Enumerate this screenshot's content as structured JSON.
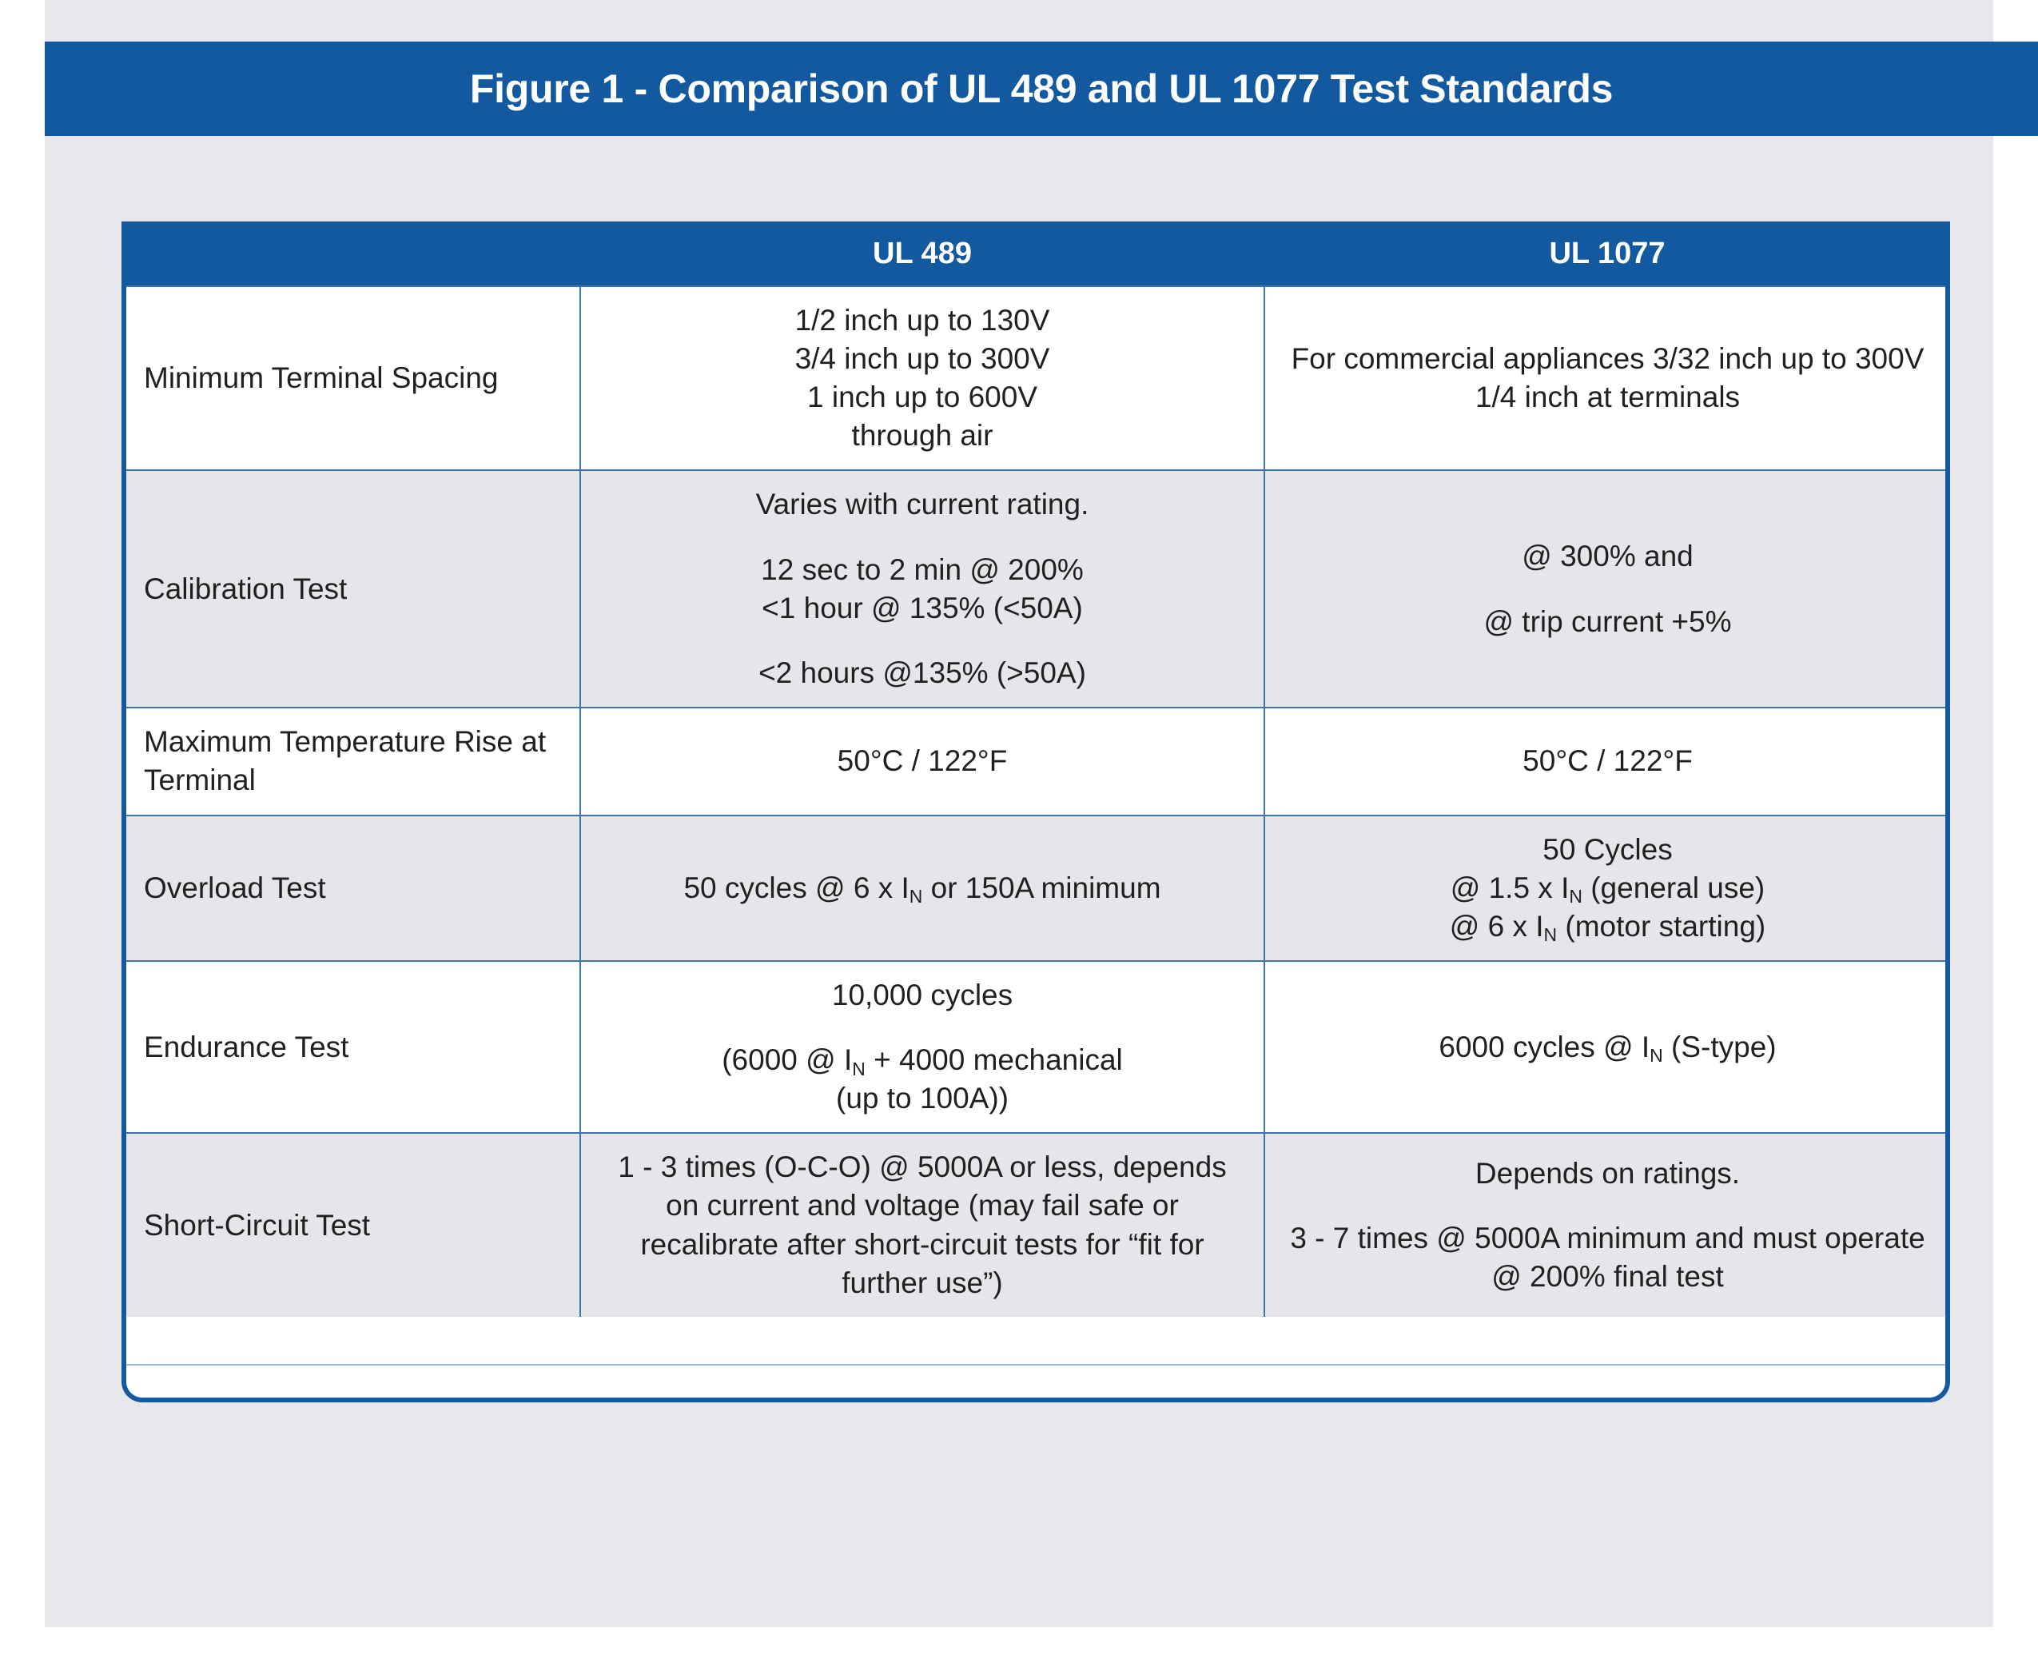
{
  "figure": {
    "title": "Figure 1 - Comparison of UL 489 and UL 1077 Test Standards",
    "accent_color": "#12599f",
    "stripe_color": "#e5e6ea",
    "page_bg": "#e7e8ec",
    "grid_color": "#3d74b0"
  },
  "table": {
    "columns": [
      "",
      "UL 489",
      "UL 1077"
    ],
    "rows": [
      {
        "label": "Minimum Terminal Spacing",
        "ul489_lines": [
          "1/2 inch up to 130V",
          "3/4 inch up to 300V",
          "1 inch up to 600V",
          "through air"
        ],
        "ul1077_lines": [
          "For commercial appliances 3/32 inch up to 300V 1/4 inch at terminals"
        ]
      },
      {
        "label": "Calibration Test",
        "ul489_lines": [
          "Varies with current rating.",
          "",
          "12 sec to 2 min @ 200%",
          "<1 hour @ 135% (<50A)",
          "",
          "<2 hours @135% (>50A)"
        ],
        "ul1077_lines": [
          "@ 300% and",
          "",
          "@ trip current +5%"
        ]
      },
      {
        "label": "Maximum Temperature Rise at Terminal",
        "ul489_lines": [
          "50°C / 122°F"
        ],
        "ul1077_lines": [
          "50°C / 122°F"
        ]
      },
      {
        "label": "Overload Test",
        "ul489_lines": [
          "50 cycles @ 6 x Iₙ  or 150A minimum"
        ],
        "ul1077_lines": [
          "50 Cycles",
          "@ 1.5 x Iₙ  (general use)",
          "@ 6 x Iₙ  (motor starting)"
        ]
      },
      {
        "label": "Endurance Test",
        "ul489_lines": [
          "10,000 cycles",
          "",
          "(6000 @ Iₙ + 4000 mechanical",
          "(up to 100A))"
        ],
        "ul1077_lines": [
          "6000 cycles @ Iₙ (S-type)"
        ]
      },
      {
        "label": "Short-Circuit Test",
        "ul489_lines": [
          "1 - 3 times (O-C-O) @ 5000A or less, depends on current and voltage (may fail safe or recalibrate after short-circuit tests for “fit for further use”)"
        ],
        "ul1077_lines": [
          "Depends on ratings.",
          "",
          "3 - 7 times @ 5000A minimum and must operate @ 200% final test"
        ]
      }
    ]
  }
}
